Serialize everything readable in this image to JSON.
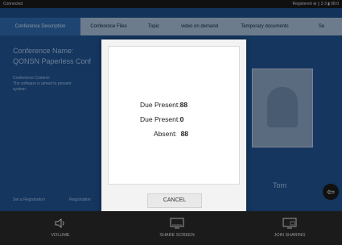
{
  "status_bar": {
    "left": "Connected",
    "right": "Registered   ⊕ ▯ 3 3  ▮ 08:0"
  },
  "tabs": [
    {
      "label": "Conference Description",
      "active": true
    },
    {
      "label": "Conference Files",
      "active": false
    },
    {
      "label": "Topic",
      "active": false
    },
    {
      "label": "video on demand",
      "active": false
    },
    {
      "label": "Temporary documents",
      "active": false
    },
    {
      "label": "Se",
      "active": false
    }
  ],
  "background": {
    "conference_name_label": "Conference Name:",
    "conference_name_value": "QONSN Paperless Conf",
    "conference_content_label": "Conference Content:",
    "conference_content_value_1": "The software is aimed to present",
    "conference_content_value_2": "system",
    "bottom_left_1": "Set a Registration",
    "bottom_left_2": "Registration",
    "person_name": "Tom"
  },
  "dialog": {
    "due_present_label": "Due Present:",
    "due_present_value": "88",
    "due_present_label_2": "Due Present:",
    "due_present_value_2": "0",
    "absent_label": "Absent:",
    "absent_value": "88",
    "cancel_label": "CANCEL"
  },
  "bottom_bar": {
    "volume_label": "VOLUME",
    "share_screen_label": "SHARE SCREEN",
    "join_sharing_label": "JOIN SHARING",
    "volume_icon": "speaker-icon",
    "share_icon": "monitor-icon",
    "join_icon": "monitor-icon"
  },
  "colors": {
    "background": "#1f5392",
    "active_tab": "#2f6bb0",
    "inactive_tab": "#a7bfd9",
    "bottom_bar": "#1b1b1b"
  }
}
